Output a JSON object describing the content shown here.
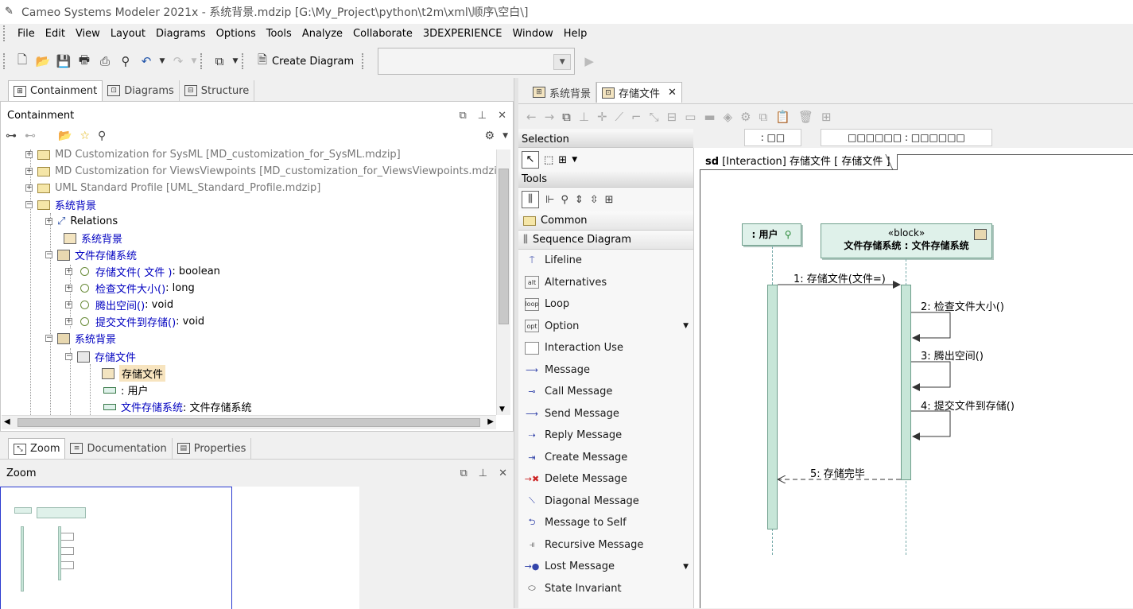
{
  "window": {
    "title": "Cameo Systems Modeler 2021x - 系统背景.mdzip [G:\\My_Project\\python\\t2m\\xml\\顺序\\空白\\]"
  },
  "menu": [
    "File",
    "Edit",
    "View",
    "Layout",
    "Diagrams",
    "Options",
    "Tools",
    "Analyze",
    "Collaborate",
    "3DEXPERIENCE",
    "Window",
    "Help"
  ],
  "toolbar": {
    "create_diagram": "Create Diagram"
  },
  "left_tabs": [
    "Containment",
    "Diagrams",
    "Structure"
  ],
  "containment": {
    "title": "Containment",
    "tree": [
      {
        "text": "MD Customization for SysML [MD_customization_for_SysML.mdzip]"
      },
      {
        "text": "MD Customization for ViewsViewpoints [MD_customization_for_ViewsViewpoints.mdzip]"
      },
      {
        "text": "UML Standard Profile [UML_Standard_Profile.mdzip]"
      },
      {
        "text": "系统背景"
      },
      {
        "text": "Relations"
      },
      {
        "text": "系统背景"
      },
      {
        "text": "文件存储系统"
      },
      {
        "name": "存储文件( 文件 )",
        "type": " : boolean"
      },
      {
        "name": "检查文件大小()",
        "type": " : long"
      },
      {
        "name": "腾出空间()",
        "type": " : void"
      },
      {
        "name": "提交文件到存储()",
        "type": " : void"
      },
      {
        "text": "系统背景"
      },
      {
        "text": "存储文件"
      },
      {
        "text": "存储文件"
      },
      {
        "text": " : 用户"
      },
      {
        "name": "文件存储系统",
        "type": " : 文件存储系统"
      }
    ]
  },
  "bottom_tabs": [
    "Zoom",
    "Documentation",
    "Properties"
  ],
  "zoom": {
    "title": "Zoom"
  },
  "diagram_tabs": [
    "系统背景",
    "存储文件"
  ],
  "palette": {
    "selection": "Selection",
    "tools": "Tools",
    "groups": [
      "Common",
      "Sequence Diagram"
    ],
    "items": [
      "Lifeline",
      "Alternatives",
      "Loop",
      "Option",
      "Interaction Use",
      "Message",
      "Call Message",
      "Send Message",
      "Reply Message",
      "Create Message",
      "Delete Message",
      "Diagonal Message",
      "Message to Self",
      "Recursive Message",
      "Lost Message",
      "State Invariant"
    ]
  },
  "canvas": {
    "header_fields": [
      ": □□",
      "□□□□□□ : □□□□□□"
    ],
    "frame_kind": "sd",
    "frame_label": "[Interaction] 存储文件 [ 存储文件 ]",
    "lifeline1": ": 用户",
    "lifeline2_stereo": "«block»",
    "lifeline2": "文件存储系统 : 文件存储系统",
    "messages": [
      "1: 存储文件(文件=)",
      "2: 检查文件大小()",
      "3: 腾出空间()",
      "4: 提交文件到存储()",
      "5: 存储完毕"
    ]
  },
  "colors": {
    "lifeline_fill": "#dff1ea",
    "activation": "#c7e6d8",
    "link_blue": "#0000c0"
  }
}
